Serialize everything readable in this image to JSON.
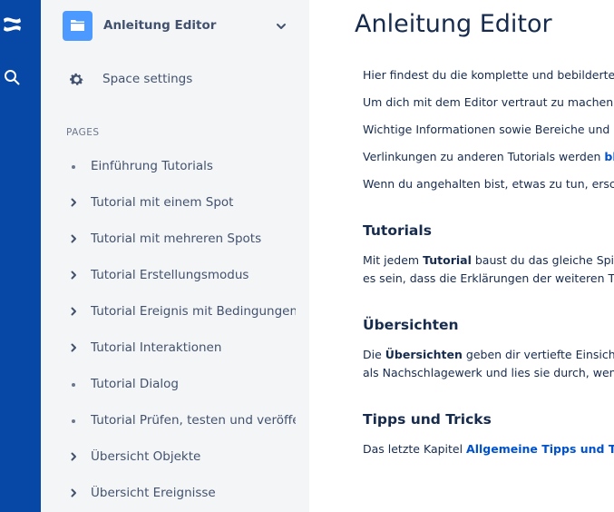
{
  "rail": {
    "logo_icon": "confluence-logo-icon",
    "search_icon": "search-icon",
    "color": "#0747a6"
  },
  "space": {
    "name": "Anleitung Editor",
    "avatar_icon": "folder-icon"
  },
  "settings": {
    "label": "Space settings",
    "icon": "gear-icon"
  },
  "pages_heading": "PAGES",
  "tree": [
    {
      "label": "Einführung Tutorials",
      "marker": "bullet"
    },
    {
      "label": "Tutorial mit einem Spot",
      "marker": "chevron"
    },
    {
      "label": "Tutorial mit mehreren Spots",
      "marker": "chevron"
    },
    {
      "label": "Tutorial Erstellungsmodus",
      "marker": "chevron"
    },
    {
      "label": "Tutorial Ereignis mit Bedingungen",
      "marker": "chevron"
    },
    {
      "label": "Tutorial Interaktionen",
      "marker": "chevron"
    },
    {
      "label": "Tutorial Dialog",
      "marker": "bullet"
    },
    {
      "label": "Tutorial Prüfen, testen und veröffentl",
      "marker": "bullet"
    },
    {
      "label": "Übersicht Objekte",
      "marker": "chevron"
    },
    {
      "label": "Übersicht Ereignisse",
      "marker": "chevron"
    }
  ],
  "main": {
    "title": "Anleitung Editor",
    "intro": [
      "Hier findest du die komplette und bebilderte",
      "Um dich mit dem Editor vertraut zu machen,",
      "Wichtige Informationen sowie Bereiche und E",
      "Wenn du angehalten bist, etwas zu tun, ersch"
    ],
    "links_line": {
      "prefix": "Verlinkungen zu anderen Tutorials werden ",
      "link": "bl"
    },
    "tutorials": {
      "heading": "Tutorials",
      "line1_prefix": "Mit jedem ",
      "line1_bold": "Tutorial",
      "line1_suffix": " baust du das gleiche Spie",
      "line2": "es sein, dass die Erklärungen der weiteren Tu"
    },
    "uebersichten": {
      "heading": "Übersichten",
      "line1_prefix": "Die ",
      "line1_bold": "Übersichten",
      "line1_suffix": " geben dir vertiefte Einsichte",
      "line2": "als Nachschlagewerk und lies sie durch, wenn"
    },
    "tipps": {
      "heading": "Tipps und Tricks",
      "line1_prefix": "Das letzte Kapitel ",
      "line1_link": "Allgemeine Tipps und Tric"
    }
  },
  "colors": {
    "link": "#0052cc",
    "sidebar_bg": "#f4f5f7",
    "text": "#172b4d",
    "muted": "#42526e"
  }
}
